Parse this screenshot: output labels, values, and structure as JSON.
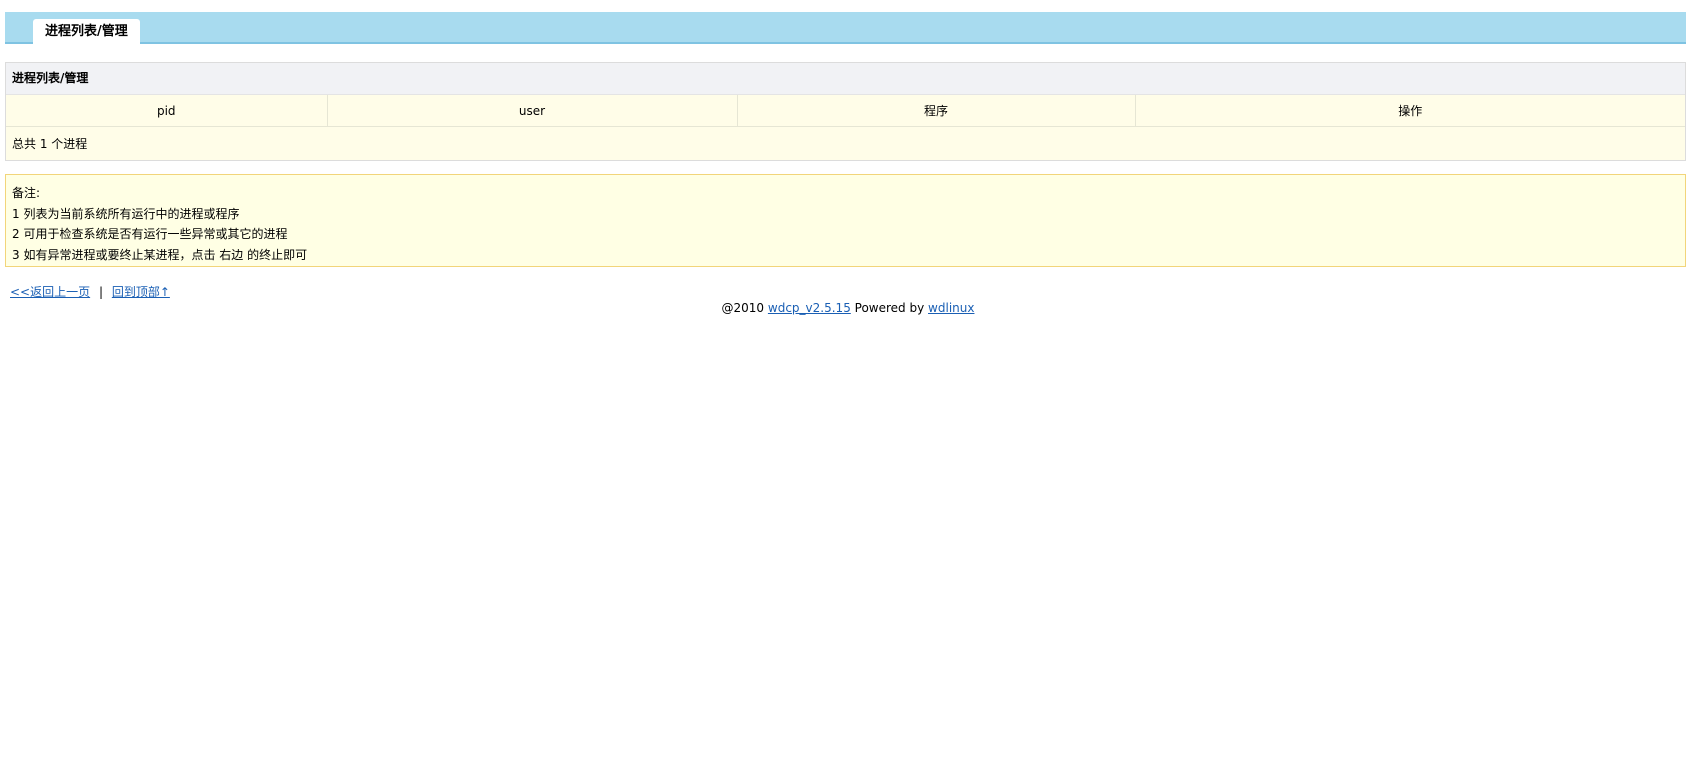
{
  "tab": {
    "label": "进程列表/管理"
  },
  "panel": {
    "title": "进程列表/管理",
    "columns": [
      "pid",
      "user",
      "程序",
      "操作"
    ],
    "total_text": "总共 1 个进程"
  },
  "notes": {
    "title": "备注:",
    "lines": [
      "1 列表为当前系统所有运行中的进程或程序",
      "2 可用于检查系统是否有运行一些异常或其它的进程",
      "3 如有异常进程或要终止某进程，点击 右边 的终止即可"
    ]
  },
  "links": {
    "back": "<<返回上一页",
    "separator": "|",
    "top": "回到顶部↑"
  },
  "footer": {
    "prefix": "@2010",
    "product_link": "wdcp_v2.5.15",
    "powered_by": "Powered by",
    "vendor_link": "wdlinux"
  }
}
